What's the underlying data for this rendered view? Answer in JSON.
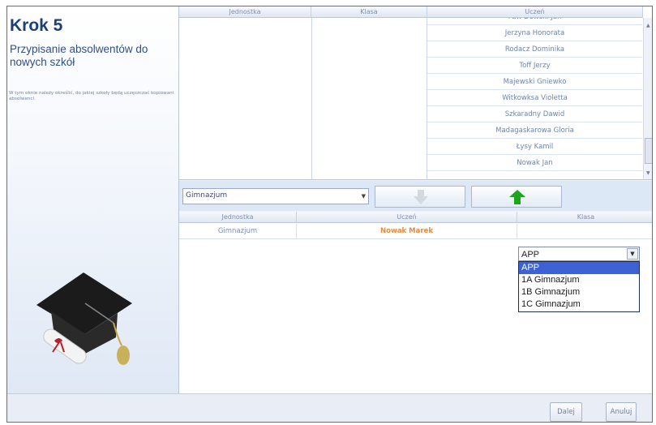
{
  "left_panel": {
    "title": "Krok 5",
    "subtitle": "Przypisanie absolwentów do nowych szkół",
    "description": "W tym oknie należy określić, do jakiej szkoły będą uczęszczać kopiowani absolwenci."
  },
  "top_grid": {
    "headers": [
      "Jednostka",
      "Klasa",
      "Uczeń"
    ],
    "students": [
      "Paw Dowski Jan",
      "Jerzyna Honorata",
      "Rodacz Dominika",
      "Toff Jerzy",
      "Majewski Gniewko",
      "Witkowksa Violetta",
      "Szkaradny Dawid",
      "Madagaskarowa Gloria",
      "Łysy Kamil",
      "Nowak Jan"
    ]
  },
  "toolbar": {
    "school_select_value": "Gimnazjum",
    "down_icon": "arrow-down-icon",
    "up_icon": "arrow-up-icon"
  },
  "bottom_grid": {
    "headers": [
      "Jednostka",
      "Uczeń",
      "Klasa"
    ],
    "row": {
      "unit": "Gimnazjum",
      "student": "Nowak Marek"
    },
    "class_select": {
      "value": "APP",
      "options": [
        "APP",
        "1A Gimnazjum",
        "1B Gimnazjum",
        "1C Gimnazjum"
      ],
      "selected_index": 0
    }
  },
  "footer": {
    "next_label": "Dalej",
    "cancel_label": "Anuluj"
  },
  "colors": {
    "accent": "#1d3f78",
    "highlight": "#3d62d6",
    "arrow_green": "#1ea51e",
    "student_name": "#e48b3e"
  }
}
